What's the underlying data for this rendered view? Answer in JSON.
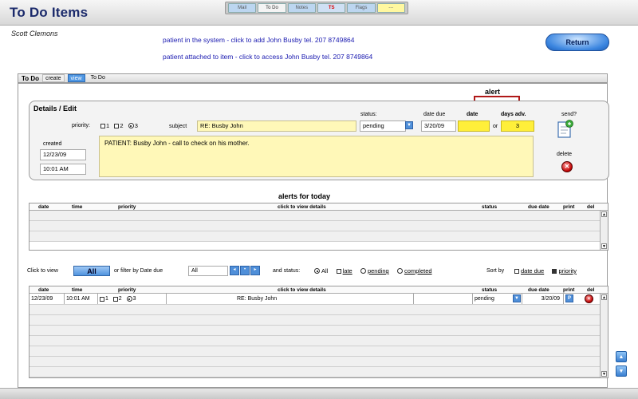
{
  "app": {
    "title": "To Do Items",
    "user": "Scott Clemons",
    "nav_tabs": [
      {
        "label": "Mail",
        "state": "normal"
      },
      {
        "label": "To Do",
        "state": "active"
      },
      {
        "label": "Notes",
        "state": "normal"
      },
      {
        "label": "TS",
        "state": "red"
      },
      {
        "label": "Flags",
        "state": "normal"
      },
      {
        "label": "---",
        "state": "yellow"
      }
    ]
  },
  "patient_links": {
    "in_system": "patient in the system - click to add John Busby   tel. 207 8749864",
    "attached": "patient attached to item - click to access John Busby  tel. 207 8749864"
  },
  "return_label": "Return",
  "subtabs": {
    "label": "To Do",
    "items": [
      "create",
      "view",
      "To Do"
    ],
    "active": "view"
  },
  "details": {
    "title": "Details / Edit",
    "priority_label": "priority:",
    "priority_options": [
      "1",
      "2",
      "3"
    ],
    "priority_selected": "3",
    "subject_label": "subject",
    "subject_value": "RE: Busby John",
    "status_label": "status:",
    "status_value": "pending",
    "date_due_label": "date due",
    "date_due_value": "3/20/09",
    "alert_title": "alert",
    "alert_date_label": "date",
    "alert_or": "or",
    "days_adv_label": "days adv.",
    "days_adv_value": "3",
    "created_label": "created",
    "created_date": "12/23/09",
    "created_time": "10:01 AM",
    "note": "PATIENT: Busby John - call to check on his mother.",
    "send_label": "send?",
    "delete_label": "delete"
  },
  "alerts_today": {
    "title": "alerts for today",
    "columns": {
      "date": "date",
      "time": "time",
      "priority": "priority",
      "details": "click to view details",
      "status": "status",
      "due": "due date",
      "print": "print",
      "del": "del"
    }
  },
  "filter": {
    "click_to_view": "Click to view",
    "all_button": "All",
    "or_filter": "or filter by Date due",
    "date_select": "All",
    "and_status": "and status:",
    "status_options": [
      "All",
      "late",
      "pending",
      "completed"
    ],
    "status_selected": "All",
    "sort_by": "Sort by",
    "sort_options": [
      "date due",
      "priority"
    ],
    "sort_selected": "priority"
  },
  "list": {
    "columns": {
      "date": "date",
      "time": "time",
      "priority": "priority",
      "details": "click to view details",
      "status": "status",
      "due": "due date",
      "print": "print",
      "del": "del"
    },
    "rows": [
      {
        "date": "12/23/09",
        "time": "10:01 AM",
        "prio": [
          "1",
          "2",
          "3"
        ],
        "prio_selected": "3",
        "details": "RE: Busby John",
        "status": "pending",
        "due": "3/20/09",
        "print": "P"
      }
    ]
  },
  "colors": {
    "accent_blue": "#4f93de",
    "highlight_yellow": "#fff8b8",
    "alert_red": "#b01818",
    "title_navy": "#1b2a6b"
  }
}
